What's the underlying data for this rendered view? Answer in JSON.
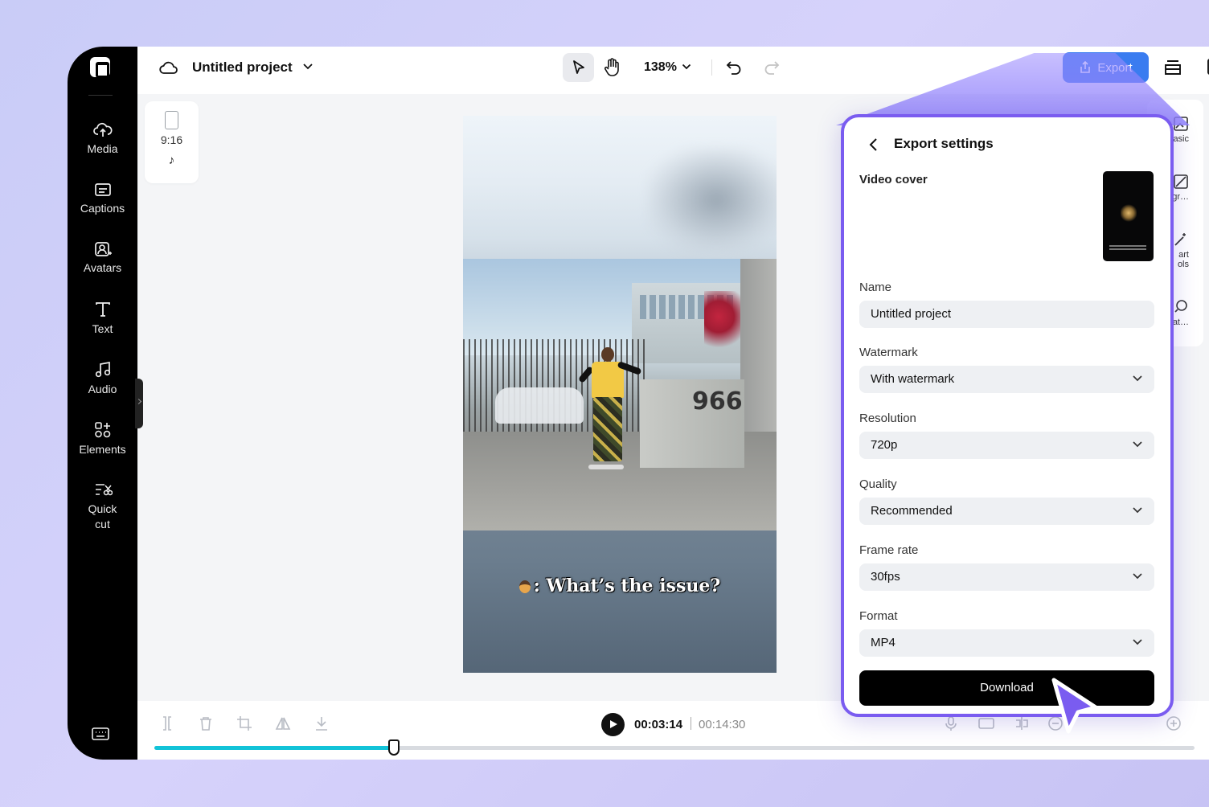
{
  "header": {
    "project_title": "Untitled project",
    "zoom": "138%",
    "export_label": "Export"
  },
  "sidebar": {
    "items": [
      {
        "label": "Media",
        "icon": "cloud-upload-icon"
      },
      {
        "label": "Captions",
        "icon": "captions-icon"
      },
      {
        "label": "Avatars",
        "icon": "avatar-icon"
      },
      {
        "label": "Text",
        "icon": "text-icon"
      },
      {
        "label": "Audio",
        "icon": "music-note-icon"
      },
      {
        "label": "Elements",
        "icon": "elements-icon"
      },
      {
        "label": "Quick",
        "label2": "cut",
        "icon": "quick-cut-icon"
      }
    ]
  },
  "canvas": {
    "aspect_ratio": "9:16",
    "platform_icon": "♪",
    "caption": ": What’s the issue?",
    "scene_number": "966"
  },
  "right_strip": {
    "items": [
      "asic",
      "kgr…",
      "art",
      "ols",
      "mat…"
    ]
  },
  "export_panel": {
    "title": "Export settings",
    "video_cover_label": "Video cover",
    "fields": {
      "name": {
        "label": "Name",
        "value": "Untitled project"
      },
      "watermark": {
        "label": "Watermark",
        "value": "With watermark"
      },
      "resolution": {
        "label": "Resolution",
        "value": "720p"
      },
      "quality": {
        "label": "Quality",
        "value": "Recommended"
      },
      "frame_rate": {
        "label": "Frame rate",
        "value": "30fps"
      },
      "format": {
        "label": "Format",
        "value": "MP4"
      }
    },
    "download_label": "Download"
  },
  "timeline": {
    "current_time": "00:03:14",
    "total_time": "00:14:30",
    "progress": 0.23
  },
  "colors": {
    "export_button": "#3a7cf0",
    "panel_border": "#7a5cf0",
    "progress_fill": "#12c3d8"
  }
}
